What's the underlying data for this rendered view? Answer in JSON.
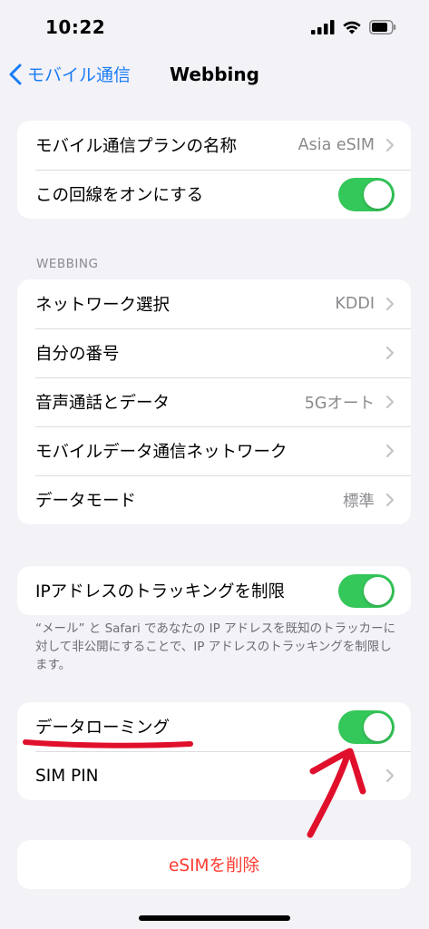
{
  "status_bar": {
    "time": "10:22"
  },
  "nav": {
    "back_label": "モバイル通信",
    "title": "Webbing"
  },
  "group1": {
    "plan_name_label": "モバイル通信プランの名称",
    "plan_name_value": "Asia eSIM",
    "line_on_label": "この回線をオンにする",
    "line_on_toggle": true
  },
  "section_header": "WEBBING",
  "group2": {
    "network_label": "ネットワーク選択",
    "network_value": "KDDI",
    "my_number_label": "自分の番号",
    "voice_data_label": "音声通話とデータ",
    "voice_data_value": "5Gオート",
    "mobile_data_network_label": "モバイルデータ通信ネットワーク",
    "data_mode_label": "データモード",
    "data_mode_value": "標準"
  },
  "group3": {
    "ip_tracking_label": "IPアドレスのトラッキングを制限",
    "ip_tracking_toggle": true,
    "footer": "“メール” と Safari であなたの IP アドレスを既知のトラッカーに対して非公開にすることで、IP アドレスのトラッキングを制限します。"
  },
  "group4": {
    "data_roaming_label": "データローミング",
    "data_roaming_toggle": true,
    "sim_pin_label": "SIM PIN"
  },
  "delete_label": "eSIMを削除",
  "colors": {
    "accent": "#1a7cf5",
    "toggle_on": "#34c759",
    "destructive": "#ff3b30",
    "annotation": "#e0102c"
  }
}
